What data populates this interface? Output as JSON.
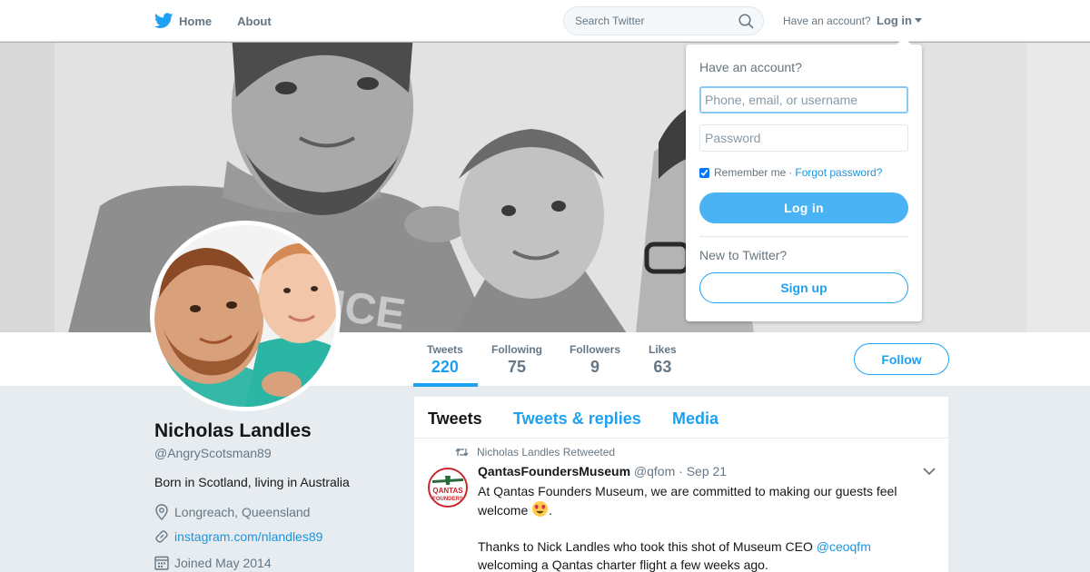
{
  "nav": {
    "home_label": "Home",
    "about_label": "About",
    "search_placeholder": "Search Twitter",
    "have_account_label": "Have an account?",
    "login_label": "Log in"
  },
  "profile": {
    "name": "Nicholas Landles",
    "handle": "@AngryScotsman89",
    "bio": "Born in Scotland, living in Australia",
    "location": "Longreach, Queensland",
    "website": "instagram.com/nlandles89",
    "joined": "Joined May 2014",
    "follow_label": "Follow"
  },
  "stats": [
    {
      "label": "Tweets",
      "value": "220",
      "active": true
    },
    {
      "label": "Following",
      "value": "75"
    },
    {
      "label": "Followers",
      "value": "9"
    },
    {
      "label": "Likes",
      "value": "63"
    }
  ],
  "tabs": [
    "Tweets",
    "Tweets & replies",
    "Media"
  ],
  "tweet": {
    "retweet_line": "Nicholas Landles Retweeted",
    "author_name": "QantasFoundersMuseum",
    "author_handle": "@qfom",
    "dot": "·",
    "date": "Sep 21",
    "text_line1": "At Qantas Founders Museum, we are committed to making our guests feel welcome",
    "text_line1_end": ".",
    "text_line2_before": "Thanks to Nick Landles who took this shot of Museum CEO ",
    "mention": "@ceoqfm",
    "text_line2_after": " welcoming a Qantas charter flight a few weeks ago.",
    "logo_text_top": "QANTAS",
    "logo_text_bottom": "FOUNDERS"
  },
  "login_dropdown": {
    "title": "Have an account?",
    "username_placeholder": "Phone, email, or username",
    "password_placeholder": "Password",
    "remember_label": "Remember me",
    "separator": "·",
    "forgot_label": "Forgot password?",
    "remember_checked": true,
    "login_button": "Log in",
    "new_label": "New to Twitter?",
    "signup_button": "Sign up"
  },
  "colors": {
    "brand_blue": "#1da1f2",
    "link_blue": "#1b95e0",
    "login_button_blue": "#4ab3f4",
    "background": "#e6ecf0"
  }
}
